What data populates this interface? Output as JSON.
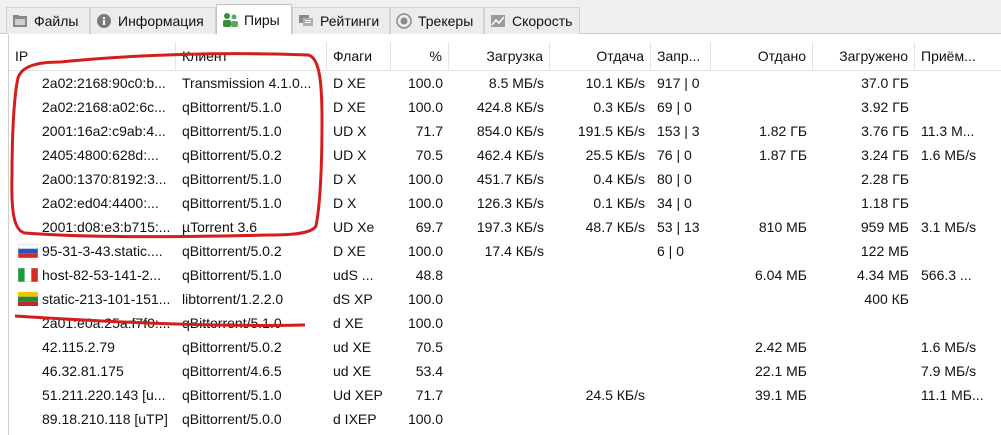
{
  "tabs": [
    {
      "label": "Файлы",
      "icon": "files-icon"
    },
    {
      "label": "Информация",
      "icon": "info-icon"
    },
    {
      "label": "Пиры",
      "icon": "peers-icon"
    },
    {
      "label": "Рейтинги",
      "icon": "ratings-icon"
    },
    {
      "label": "Трекеры",
      "icon": "trackers-icon"
    },
    {
      "label": "Скорость",
      "icon": "speed-icon"
    }
  ],
  "active_tab": "Пиры",
  "columns": [
    "IP",
    "Клиент",
    "Флаги",
    "%",
    "Загрузка",
    "Отдача",
    "Запр...",
    "Отдано",
    "Загружено",
    "Приём..."
  ],
  "rows": [
    {
      "ip": "2a02:2168:90c0:b...",
      "flag": "",
      "client": "Transmission 4.1.0...",
      "flags": "D XE",
      "pct": "100.0",
      "down": "8.5 МБ/s",
      "up": "10.1 КБ/s",
      "req": "917 | 0",
      "uploaded": "",
      "downloaded": "37.0 ГБ",
      "recv": ""
    },
    {
      "ip": "2a02:2168:a02:6c...",
      "flag": "",
      "client": "qBittorrent/5.1.0",
      "flags": "D XE",
      "pct": "100.0",
      "down": "424.8 КБ/s",
      "up": "0.3 КБ/s",
      "req": "69 | 0",
      "uploaded": "",
      "downloaded": "3.92 ГБ",
      "recv": ""
    },
    {
      "ip": "2001:16a2:c9ab:4...",
      "flag": "",
      "client": "qBittorrent/5.1.0",
      "flags": "UD X",
      "pct": "71.7",
      "down": "854.0 КБ/s",
      "up": "191.5 КБ/s",
      "req": "153 | 3",
      "uploaded": "1.82 ГБ",
      "downloaded": "3.76 ГБ",
      "recv": "11.3 М..."
    },
    {
      "ip": "2405:4800:628d:...",
      "flag": "",
      "client": "qBittorrent/5.0.2",
      "flags": "UD X",
      "pct": "70.5",
      "down": "462.4 КБ/s",
      "up": "25.5 КБ/s",
      "req": "76 | 0",
      "uploaded": "1.87 ГБ",
      "downloaded": "3.24 ГБ",
      "recv": "1.6 МБ/s"
    },
    {
      "ip": "2a00:1370:8192:3...",
      "flag": "",
      "client": "qBittorrent/5.1.0",
      "flags": "D X",
      "pct": "100.0",
      "down": "451.7 КБ/s",
      "up": "0.4 КБ/s",
      "req": "80 | 0",
      "uploaded": "",
      "downloaded": "2.28 ГБ",
      "recv": ""
    },
    {
      "ip": "2a02:ed04:4400:...",
      "flag": "",
      "client": "qBittorrent/5.1.0",
      "flags": "D X",
      "pct": "100.0",
      "down": "126.3 КБ/s",
      "up": "0.1 КБ/s",
      "req": "34 | 0",
      "uploaded": "",
      "downloaded": "1.18 ГБ",
      "recv": ""
    },
    {
      "ip": "2001:d08:e3:b715:...",
      "flag": "",
      "client": "µTorrent 3.6",
      "flags": "UD Xe",
      "pct": "69.7",
      "down": "197.3 КБ/s",
      "up": "48.7 КБ/s",
      "req": "53 | 13",
      "uploaded": "810 МБ",
      "downloaded": "959 МБ",
      "recv": "3.1 МБ/s"
    },
    {
      "ip": "95-31-3-43.static....",
      "flag": "ru",
      "client": "qBittorrent/5.0.2",
      "flags": "D XE",
      "pct": "100.0",
      "down": "17.4 КБ/s",
      "up": "",
      "req": "6 | 0",
      "uploaded": "",
      "downloaded": "122 МБ",
      "recv": ""
    },
    {
      "ip": "host-82-53-141-2...",
      "flag": "it",
      "client": "qBittorrent/5.1.0",
      "flags": "udS ...",
      "pct": "48.8",
      "down": "",
      "up": "",
      "req": "",
      "uploaded": "6.04 МБ",
      "downloaded": "4.34 МБ",
      "recv": "566.3 ..."
    },
    {
      "ip": "static-213-101-151...",
      "flag": "lt",
      "client": "libtorrent/1.2.2.0",
      "flags": "dS XP",
      "pct": "100.0",
      "down": "",
      "up": "",
      "req": "",
      "uploaded": "",
      "downloaded": "400 КБ",
      "recv": ""
    },
    {
      "ip": "2a01:e0a:25a:f7f0:...",
      "flag": "",
      "client": "qBittorrent/5.1.0",
      "flags": "d XE",
      "pct": "100.0",
      "down": "",
      "up": "",
      "req": "",
      "uploaded": "",
      "downloaded": "",
      "recv": ""
    },
    {
      "ip": "42.115.2.79",
      "flag": "",
      "client": "qBittorrent/5.0.2",
      "flags": "ud XE",
      "pct": "70.5",
      "down": "",
      "up": "",
      "req": "",
      "uploaded": "2.42 МБ",
      "downloaded": "",
      "recv": "1.6 МБ/s"
    },
    {
      "ip": "46.32.81.175",
      "flag": "",
      "client": "qBittorrent/4.6.5",
      "flags": "ud XE",
      "pct": "53.4",
      "down": "",
      "up": "",
      "req": "",
      "uploaded": "22.1 МБ",
      "downloaded": "",
      "recv": "7.9 МБ/s"
    },
    {
      "ip": "51.211.220.143 [u...",
      "flag": "",
      "client": "qBittorrent/5.1.0",
      "flags": "Ud XEP",
      "pct": "71.7",
      "down": "",
      "up": "24.5 КБ/s",
      "req": "",
      "uploaded": "39.1 МБ",
      "downloaded": "",
      "recv": "11.1 МБ..."
    },
    {
      "ip": "89.18.210.118 [uTP]",
      "flag": "",
      "client": "qBittorrent/5.0.0",
      "flags": "d IXEP",
      "pct": "100.0",
      "down": "",
      "up": "",
      "req": "",
      "uploaded": "",
      "downloaded": "",
      "recv": ""
    }
  ],
  "colors": {
    "annotation": "#d41e1e",
    "tab_active": "#ffffff",
    "tabbar": "#f0f0f0"
  }
}
